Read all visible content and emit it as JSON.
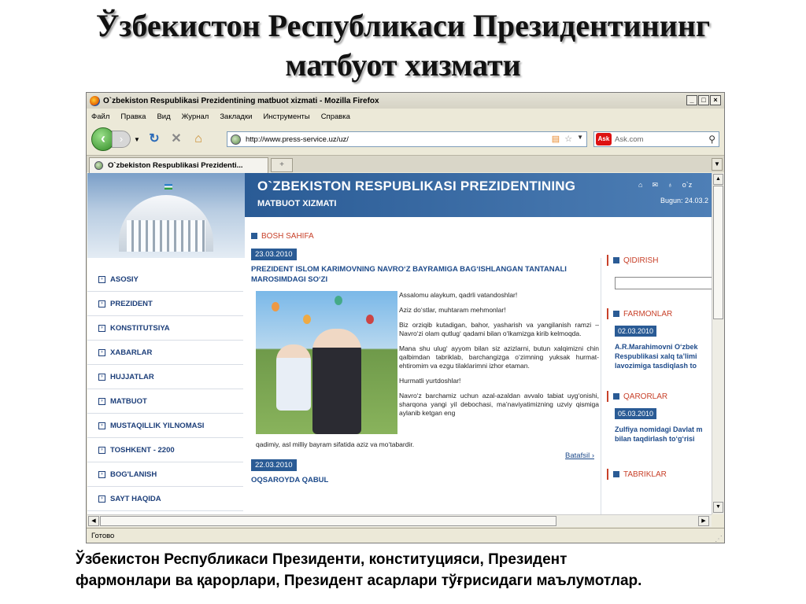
{
  "slide": {
    "title_line1": "Ўзбекистон Республикаси Президентининг",
    "title_line2": "матбуот хизмати",
    "caption_line1": "Ўзбекистон Республикаси Президенти, конституцияси, Президент",
    "caption_line2": "фармонлари ва қарорлари, Президент асарлари тўғрисидаги маълумотлар."
  },
  "browser": {
    "window_title": "O`zbekiston Respublikasi Prezidentining matbuot xizmati - Mozilla Firefox",
    "menu": [
      "Файл",
      "Правка",
      "Вид",
      "Журнал",
      "Закладки",
      "Инструменты",
      "Справка"
    ],
    "url": "http://www.press-service.uz/uz/",
    "search_placeholder": "Ask.com",
    "tab_label": "O`zbekiston Respublikasi Prezidenti...",
    "status": "Готово"
  },
  "site": {
    "header_line1": "O`ZBEKISTON RESPUBLIKASI PREZIDENTINING",
    "header_line2": "MATBUOT XIZMATI",
    "header_lang": "o`z",
    "header_date": "Bugun: 24.03.2",
    "nav": [
      "ASOSIY",
      "PREZIDENT",
      "KONSTITUTSIYA",
      "XABARLAR",
      "HUJJATLAR",
      "MATBUOT",
      "MUSTAQILLIK YILNOMASI",
      "TOSHKENT - 2200",
      "BOG'LANISH",
      "SAYT HAQIDA"
    ],
    "breadcrumb": "BOSH SAHIFA",
    "news1": {
      "date": "23.03.2010",
      "headline": "PREZIDENT ISLOM KARIMOVNING NAVRO‘Z BAYRAMIGA BAG‘ISHLANGAN TANTANALI MAROSIMDAGI SO‘ZI",
      "p1": "Assalomu alaykum, qadrli vatandoshlar!",
      "p2": "Aziz do‘stlar, muhtaram mehmonlar!",
      "p3": "Biz orziqib kutadigan, bahor, yasharish va yangilanish ramzi – Navro‘zi olam qutlug‘ qadami bilan o‘lkamizga kirib kelmoqda.",
      "p4": "Mana shu ulug‘ ayyom bilan siz azizlarni, butun xalqimizni chin qalbimdan tabriklab, barchangizga o‘zimning yuksak hurmat-ehtiromim va ezgu tilaklarimni izhor etaman.",
      "p5": "Hurmatli yurtdoshlar!",
      "p6": "Navro‘z barchamiz uchun azal-azaldan avvalo tabiat uyg‘onishi, sharqona yangi yil debochasi, ma’naviyatimizning uzviy qismiga aylanib ketgan eng",
      "p6_tail": "qadimiy, asl milliy bayram sifatida aziz va mo‘tabardir.",
      "more": "Batafsil ›"
    },
    "news2": {
      "date": "22.03.2010",
      "headline": "OQSAROYDA QABUL"
    },
    "right": {
      "search_title": "QIDIRISH",
      "farmonlar_title": "FARMONLAR",
      "farmonlar_date": "02.03.2010",
      "farmonlar_text1": "A.R.Marahimovni O‘zbek",
      "farmonlar_text2": "Respublikasi xalq ta’limi",
      "farmonlar_text3": "lavozimiga tasdiqlash to",
      "qarorlar_title": "QARORLAR",
      "qarorlar_date": "05.03.2010",
      "qarorlar_text1": "Zulfiya nomidagi Davlat m",
      "qarorlar_text2": "bilan taqdirlash to‘g‘risi",
      "tabriklar_title": "TABRIKLAR"
    }
  }
}
